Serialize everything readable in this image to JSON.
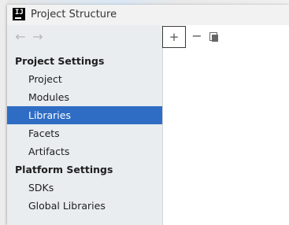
{
  "window": {
    "title": "Project Structure",
    "app_icon": "intellij-idea-icon"
  },
  "navigation": {
    "back_icon": "arrow-left-icon",
    "forward_icon": "arrow-right-icon"
  },
  "sidebar": {
    "sections": [
      {
        "title": "Project Settings",
        "items": [
          {
            "label": "Project",
            "selected": false
          },
          {
            "label": "Modules",
            "selected": false
          },
          {
            "label": "Libraries",
            "selected": true
          },
          {
            "label": "Facets",
            "selected": false
          },
          {
            "label": "Artifacts",
            "selected": false
          }
        ]
      },
      {
        "title": "Platform Settings",
        "items": [
          {
            "label": "SDKs",
            "selected": false
          },
          {
            "label": "Global Libraries",
            "selected": false
          }
        ]
      }
    ]
  },
  "toolbar": {
    "add_icon": "plus-icon",
    "remove_icon": "minus-icon",
    "copy_icon": "copy-icon",
    "add_glyph": "+",
    "remove_glyph": "−"
  },
  "colors": {
    "selection": "#2f6dc4",
    "sidebar_bg": "#e9edf0"
  }
}
